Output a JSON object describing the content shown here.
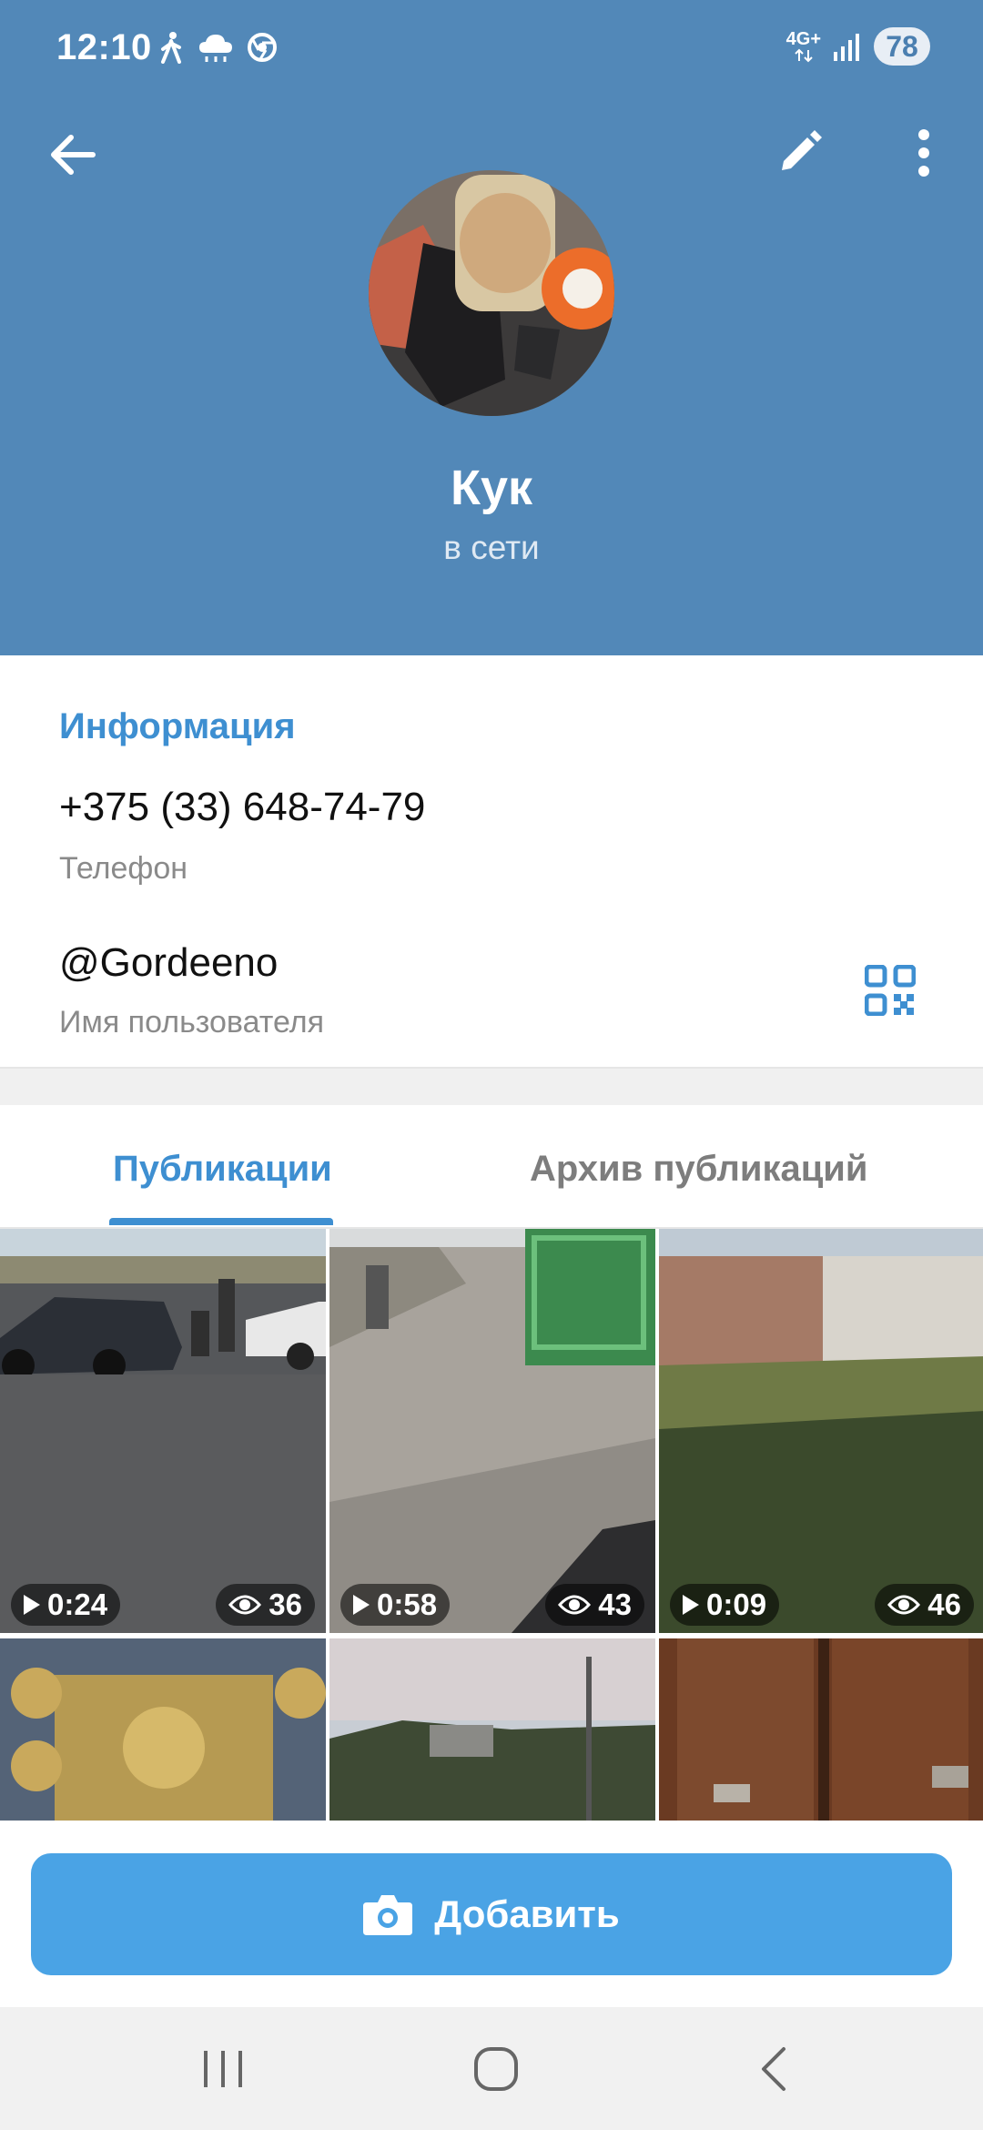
{
  "status_bar": {
    "time": "12:10",
    "network": "4G+",
    "battery": "78"
  },
  "profile": {
    "name": "Кук",
    "status": "в сети"
  },
  "info": {
    "section_title": "Информация",
    "phone": "+375 (33) 648-74-79",
    "phone_label": "Телефон",
    "username": "@Gordeeno",
    "username_label": "Имя пользователя"
  },
  "tabs": [
    {
      "label": "Публикации",
      "active": true
    },
    {
      "label": "Архив публикаций",
      "active": false
    }
  ],
  "posts": [
    {
      "duration": "0:24",
      "views": "36"
    },
    {
      "duration": "0:58",
      "views": "43"
    },
    {
      "duration": "0:09",
      "views": "46"
    },
    {},
    {},
    {}
  ],
  "add_button": {
    "label": "Добавить"
  },
  "colors": {
    "header": "#5288b8",
    "accent": "#3e8fd1",
    "button": "#4aa3e5"
  }
}
